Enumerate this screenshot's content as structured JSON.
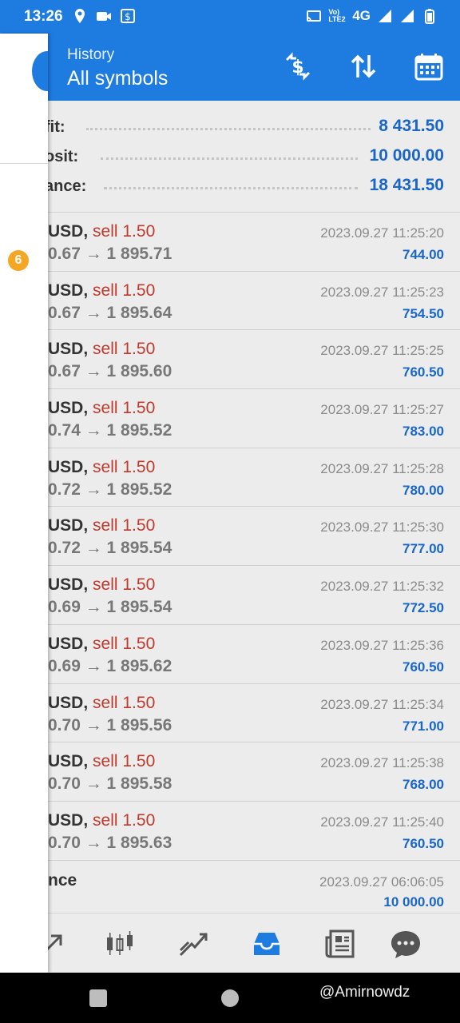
{
  "status_bar": {
    "time": "13:26",
    "network": "4G",
    "volte": "Vo) LTE2",
    "left_icons": [
      "location-icon",
      "camera-icon",
      "screenshot-icon"
    ],
    "right_icons": [
      "cast-icon",
      "signal-icon",
      "signal2-icon",
      "battery-icon"
    ]
  },
  "header": {
    "subtitle": "History",
    "title": "All symbols",
    "actions": [
      "currency-exchange-icon",
      "sort-icon",
      "calendar-icon"
    ]
  },
  "summary": {
    "rows": [
      {
        "label": "fit:",
        "value": "8 431.50"
      },
      {
        "label": "osit:",
        "value": "10 000.00"
      },
      {
        "label": "ance:",
        "value": "18 431.50"
      }
    ]
  },
  "deals": [
    {
      "symbol": "USD,",
      "type": "sell 1.50",
      "prices": "0.67 → 1 895.71",
      "time": "2023.09.27 11:25:20",
      "profit": "744.00"
    },
    {
      "symbol": "USD,",
      "type": "sell 1.50",
      "prices": "0.67 → 1 895.64",
      "time": "2023.09.27 11:25:23",
      "profit": "754.50"
    },
    {
      "symbol": "USD,",
      "type": "sell 1.50",
      "prices": "0.67 → 1 895.60",
      "time": "2023.09.27 11:25:25",
      "profit": "760.50"
    },
    {
      "symbol": "USD,",
      "type": "sell 1.50",
      "prices": "0.74 → 1 895.52",
      "time": "2023.09.27 11:25:27",
      "profit": "783.00"
    },
    {
      "symbol": "USD,",
      "type": "sell 1.50",
      "prices": "0.72 → 1 895.52",
      "time": "2023.09.27 11:25:28",
      "profit": "780.00"
    },
    {
      "symbol": "USD,",
      "type": "sell 1.50",
      "prices": "0.72 → 1 895.54",
      "time": "2023.09.27 11:25:30",
      "profit": "777.00"
    },
    {
      "symbol": "USD,",
      "type": "sell 1.50",
      "prices": "0.69 → 1 895.54",
      "time": "2023.09.27 11:25:32",
      "profit": "772.50"
    },
    {
      "symbol": "USD,",
      "type": "sell 1.50",
      "prices": "0.69 → 1 895.62",
      "time": "2023.09.27 11:25:36",
      "profit": "760.50"
    },
    {
      "symbol": "USD,",
      "type": "sell 1.50",
      "prices": "0.70 → 1 895.56",
      "time": "2023.09.27 11:25:34",
      "profit": "771.00"
    },
    {
      "symbol": "USD,",
      "type": "sell 1.50",
      "prices": "0.70 → 1 895.58",
      "time": "2023.09.27 11:25:38",
      "profit": "768.00"
    },
    {
      "symbol": "USD,",
      "type": "sell 1.50",
      "prices": "0.70 → 1 895.63",
      "time": "2023.09.27 11:25:40",
      "profit": "760.50"
    }
  ],
  "balance": {
    "label": "nce",
    "time": "2023.09.27 06:06:05",
    "amount": "10 000.00"
  },
  "bottom_nav": [
    "signal-arrow-icon",
    "candlestick-chart-icon",
    "trade-icon",
    "history-inbox-icon",
    "news-icon",
    "chat-icon"
  ],
  "drawer": {
    "badge": "6"
  },
  "watermark": "@Amirnowdz",
  "colors": {
    "primary": "#1e7be0",
    "sell": "#c0392b",
    "profit": "#1866c8",
    "badge": "#f5a623"
  }
}
